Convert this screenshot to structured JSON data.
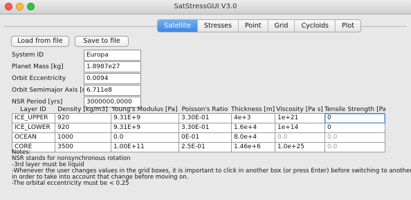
{
  "window": {
    "title": "SatStressGUI V3.0"
  },
  "tabs": [
    {
      "label": "Satellite",
      "active": true
    },
    {
      "label": "Stresses",
      "active": false
    },
    {
      "label": "Point",
      "active": false
    },
    {
      "label": "Grid",
      "active": false
    },
    {
      "label": "Cycloids",
      "active": false
    },
    {
      "label": "Plot",
      "active": false
    }
  ],
  "buttons": {
    "load": "Load from file",
    "save": "Save to file"
  },
  "params": [
    {
      "label": "System ID",
      "value": "Europa"
    },
    {
      "label": "Planet Mass [kg]",
      "value": "1.8987e27"
    },
    {
      "label": "Orbit Eccentricity",
      "value": "0.0094"
    },
    {
      "label": "Orbit Semimajor Axis [m]",
      "value": "6.711e8"
    },
    {
      "label": "NSR Period [yrs]",
      "value": "3000000.0000"
    }
  ],
  "layers": {
    "headers": [
      "Layer ID",
      "Density [kg/m3]",
      "Young's Modulus [Pa]",
      "Poisson's Ratio",
      "Thickness [m]",
      "Viscosity [Pa s]",
      "Tensile Strength [Pa]"
    ],
    "rows": [
      [
        "ICE_UPPER",
        "920",
        "9.31E+9",
        "3.30E-01",
        "4e+3",
        "1e+21",
        "0"
      ],
      [
        "ICE_LOWER",
        "920",
        "9.31E+9",
        "3.30E-01",
        "1.6e+4",
        "1e+14",
        "0"
      ],
      [
        "OCEAN",
        "1000",
        "0.0",
        "0E-01",
        "8.0e+4",
        "0.0",
        "0.0"
      ],
      [
        "CORE",
        "3500",
        "1.00E+11",
        "2.5E-01",
        "1.46e+6",
        "1.0e+25",
        "0.0"
      ]
    ]
  },
  "notes": [
    "Notes:",
    "NSR stands for nonsynchronous rotation",
    "-3rd layer must be liquid",
    "-Whenever the user changes values in the grid boxes, it is important to click in another box (or press Enter) before switching to another tab,",
    "in order to take into account that change before moving on.",
    "-The orbital eccentricity must be < 0.25"
  ]
}
